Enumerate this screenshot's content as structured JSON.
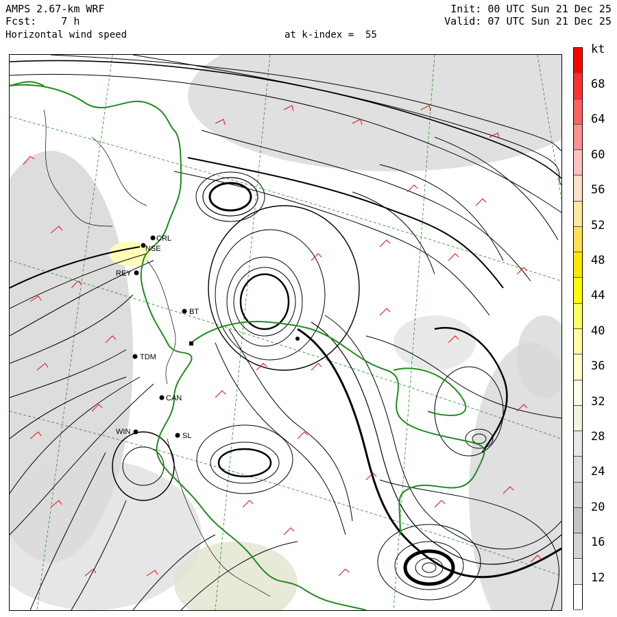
{
  "header": {
    "model": "AMPS 2.67-km WRF",
    "forecast": "Fcst:    7 h",
    "variable": "Horizontal wind speed",
    "level": "at k-index =  55",
    "init": "Init: 00 UTC Sun 21 Dec 25",
    "valid": "Valid: 07 UTC Sun 21 Dec 25"
  },
  "colorbar": {
    "unit": "kt",
    "labels": [
      "68",
      "64",
      "60",
      "56",
      "52",
      "48",
      "44",
      "40",
      "36",
      "32",
      "28",
      "24",
      "20",
      "16",
      "12"
    ],
    "colors": [
      "#ff0000",
      "#ff3030",
      "#ff6060",
      "#ff9090",
      "#ffc0c0",
      "#ffe0c8",
      "#ffe8a0",
      "#ffe050",
      "#ffe800",
      "#ffff00",
      "#ffff60",
      "#ffffa0",
      "#ffffc8",
      "#ffffe8",
      "#f4f4dc",
      "#e8e8e8",
      "#dcdcdc",
      "#d0d0d0",
      "#c4c4c4",
      "#d4d4d4",
      "#e8e8e8",
      "#ffffff"
    ]
  },
  "stations": [
    {
      "code": "CRL"
    },
    {
      "code": "NSE"
    },
    {
      "code": "REY"
    },
    {
      "code": "BT"
    },
    {
      "code": "TDM"
    },
    {
      "code": "CAN"
    },
    {
      "code": "WIN"
    },
    {
      "code": "SL"
    }
  ],
  "style": {
    "coastline": "#1e8c1e",
    "barbs": "#e01010",
    "grid": "#1e8c1e",
    "streamlines": "#000000"
  }
}
